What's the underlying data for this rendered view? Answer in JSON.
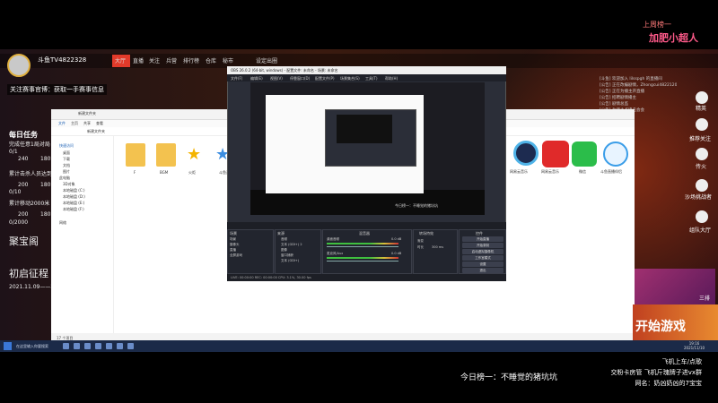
{
  "top": {
    "line1": "上周榜一",
    "line2": "加肥小超人"
  },
  "channel": {
    "username": "斗鱼TV4822328",
    "follow_text": "关注赛事官博：获取一手赛事信息"
  },
  "nav": [
    "大厅",
    "直播",
    "关注",
    "兵营",
    "排行榜",
    "仓库",
    "秘市",
    "设定出圈"
  ],
  "left_panel": {
    "tasks_title": "每日任务",
    "task1": "完成任意1局对局",
    "task1_progress": "0/1",
    "val1": "240",
    "val2": "180",
    "task2": "累计击杀人员达到10人",
    "task2_progress": "0/10",
    "val3": "200",
    "val4": "180",
    "task3": "累计移动2000米",
    "task3_progress": "0/2000",
    "val5": "200",
    "val6": "180",
    "treasure": "聚宝阁",
    "event": "初启征程",
    "event_dates": "2021.11.09——2021"
  },
  "right_panel": {
    "chat": [
      "[斗鱼] 欢迎加入 lilsspgh 的直播间",
      "[公告] 正在改编剧情，Zhongcui4822120",
      "[公告] 正在为播主开直播",
      "[公告] 招聘剧情播主",
      "[公告] 剧情总监",
      "[公告] 为播主点播名会会"
    ],
    "items": [
      "精英",
      "推荐关注",
      "传火",
      "沙场挑战者",
      "组队大厅"
    ],
    "promo_text": "三排"
  },
  "explorer": {
    "title": "新建文件夹",
    "ribbon": [
      "文件",
      "主页",
      "共享",
      "查看"
    ],
    "address": "新建文件夹",
    "sidebar": [
      "快速访问",
      "桌面",
      "下载",
      "文档",
      "图片",
      "此电脑",
      "3D对象",
      "视频",
      "图片",
      "文档",
      "下载",
      "音乐",
      "桌面",
      "本地磁盘 (C:)",
      "本地磁盘 (D:)",
      "本地磁盘 (E:)",
      "本地磁盘 (F:)",
      "网络"
    ],
    "files": [
      "F",
      "BGM",
      "火炬",
      "斗鱼直播",
      "网易云音乐",
      "网易云音乐",
      "微信",
      "斗鱼直播伴侣"
    ],
    "status": "17 个项目"
  },
  "obs": {
    "title": "OBS 26.0.2 (64-bit, windows) - 配置文件: 未命名 - 场景: 未命名",
    "menu": [
      "文件(F)",
      "编辑(E)",
      "视图(V)",
      "停靠窗口(D)",
      "配置文件(P)",
      "场景集合(S)",
      "工具(T)",
      "帮助(H)"
    ],
    "caption": "今日榜一：不睡觉的猪坑坑",
    "docks": {
      "scenes": "场景",
      "sources": "来源",
      "mixer": "混音器",
      "transitions": "转场特效",
      "controls": "控件"
    },
    "scene_items": [
      "场景",
      "摄像头",
      "直播",
      "全屏游戏"
    ],
    "source_items": [
      "音频",
      "文本 (GDI+) 2",
      "图像",
      "窗口捕获",
      "文本 (GDI+)"
    ],
    "mixer_items": [
      "桌面音频",
      "麦克风/Aux"
    ],
    "mixer_db": [
      "0.0 dB",
      "0.0 dB"
    ],
    "transition_value": "渐变",
    "duration_label": "时长",
    "duration_value": "300 ms",
    "controls": [
      "开始直播",
      "开始录制",
      "启动虚拟摄像机",
      "工作室模式",
      "设置",
      "退出"
    ],
    "status": "LIVE: 00:00:00 REC: 00:00:00 CPU: 3.1%, 30.00 fps"
  },
  "taskbar": {
    "search": "在这里输入你要搜索",
    "time": "19:16",
    "date": "2021/11/10"
  },
  "banner": {
    "start": "开始游戏"
  },
  "bottom": {
    "center": "今日榜一：不睡觉的猪坑坑",
    "right1": "飞机上车/点歌",
    "right2": "交粉卡房管 飞机斤瑰牌子进vx群",
    "right3": "网名：奶凶奶凶的7宝宝"
  }
}
